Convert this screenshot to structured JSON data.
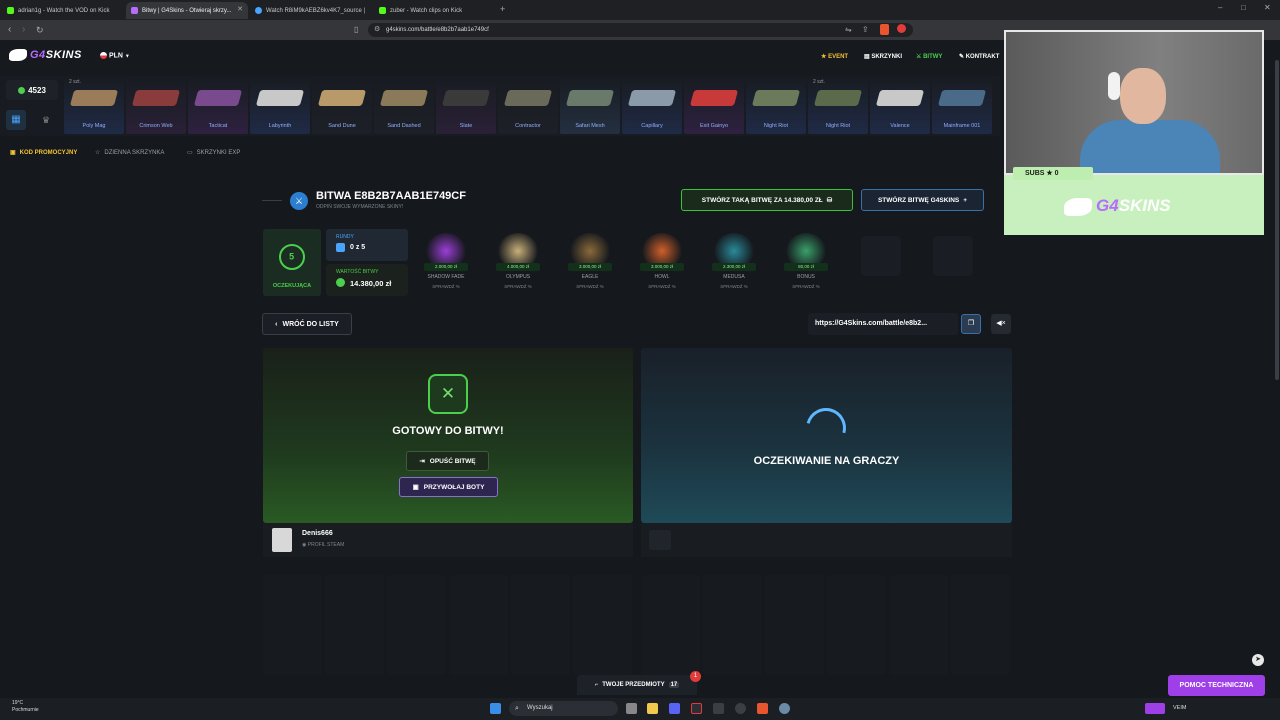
{
  "browser": {
    "tabs": [
      {
        "title": "adrian1g - Watch the VOD on Kick",
        "color": "#53fc18"
      },
      {
        "title": "Bitwy | G4Skins - Otwieraj skrzy...",
        "color": "#b86bff"
      },
      {
        "title": "Watch R8iM9kAEBZ6kv4K7_source |",
        "color": "#4aa3ff"
      },
      {
        "title": "zuber - Watch clips on Kick",
        "color": "#53fc18"
      }
    ],
    "url": "g4skins.com/battle/e8b2b7aab1e749cf"
  },
  "header": {
    "logo_prefix": "G4",
    "logo_suffix": "SKINS",
    "currency": "PLN",
    "nav": {
      "event": "EVENT",
      "cases": "SKRZYNKI",
      "battles": "BITWY",
      "contract": "KONTRAKT"
    }
  },
  "dropbar": {
    "balance": "4523",
    "drops": [
      {
        "name": "Poly Mag",
        "count": "2 szt.",
        "bg": "#1f2a45",
        "gun": "#9a7b5a"
      },
      {
        "name": "Crimson Web",
        "count": "",
        "bg": "#2a2036",
        "gun": "#8a3b3b"
      },
      {
        "name": "Tacticat",
        "count": "",
        "bg": "#2e2140",
        "gun": "#7a4a8e"
      },
      {
        "name": "Labyrinth",
        "count": "",
        "bg": "#1f2a45",
        "gun": "#c8c8c8"
      },
      {
        "name": "Sand Dune",
        "count": "",
        "bg": "#1d2026",
        "gun": "#b89a6a"
      },
      {
        "name": "Sand Dashed",
        "count": "",
        "bg": "#1d2026",
        "gun": "#8a7a5a"
      },
      {
        "name": "Slate",
        "count": "",
        "bg": "#2a2036",
        "gun": "#3a3a3a"
      },
      {
        "name": "Contractor",
        "count": "",
        "bg": "#1d2026",
        "gun": "#6a6a5a"
      },
      {
        "name": "Safari Mesh",
        "count": "",
        "bg": "#243040",
        "gun": "#6a7a6a"
      },
      {
        "name": "Capillary",
        "count": "",
        "bg": "#1f2a45",
        "gun": "#8a9aa8"
      },
      {
        "name": "Exit Gainyo",
        "count": "",
        "bg": "#2e2140",
        "gun": "#c83a3a"
      },
      {
        "name": "Night Riot",
        "count": "",
        "bg": "#1f2a45",
        "gun": "#6a7a5a"
      },
      {
        "name": "Night Riot",
        "count": "2 szt.",
        "bg": "#1f2a45",
        "gun": "#5a6a4a"
      },
      {
        "name": "Valence",
        "count": "",
        "bg": "#1f2a45",
        "gun": "#c8c8c8"
      },
      {
        "name": "Mainframe 001",
        "count": "",
        "bg": "#1f2a45",
        "gun": "#4a6a8a"
      }
    ]
  },
  "subnav": {
    "promo": "KOD PROMOCYJNY",
    "daily": "DZIENNA SKRZYNKA",
    "exp": "SKRZYNKI EXP"
  },
  "battle": {
    "title": "BITWA E8B2B7AAB1E749CF",
    "subtitle": "ODPIŃ SWOJE WYMARZONE SKINY!",
    "create_same": "STWÓRZ TAKĄ BITWĘ ZA 14.380,00 ZŁ",
    "create_g4": "STWÓRZ BITWĘ G4SKINS",
    "status_number": "5",
    "status_label": "OCZEKUJĄCA",
    "rounds_label": "RUNDY",
    "rounds_value": "0 z 5",
    "value_label": "WARTOŚĆ BITWY",
    "value": "14.380,00 zł",
    "cases": [
      {
        "name": "SHADOW FADE",
        "price": "2.000,00 zł",
        "check": "SPRAWDŹ",
        "color": "#9b3fd6"
      },
      {
        "name": "OLYMPUS",
        "price": "4.000,00 zł",
        "check": "SPRAWDŹ",
        "color": "#c9b07a"
      },
      {
        "name": "EAGLE",
        "price": "3.000,00 zł",
        "check": "SPRAWDŹ",
        "color": "#8a6a3a"
      },
      {
        "name": "HOWL",
        "price": "3.000,00 zł",
        "check": "SPRAWDŹ",
        "color": "#d0602a"
      },
      {
        "name": "MEDUSA",
        "price": "2.300,00 zł",
        "check": "SPRAWDŹ",
        "color": "#2a8a9a"
      },
      {
        "name": "BONUS",
        "price": "80,00 zł",
        "check": "SPRAWDŹ",
        "color": "#3aa06a"
      }
    ],
    "back": "WRÓĆ DO LISTY",
    "share_url": "https://G4Skins.com/battle/e8b2...",
    "ready": "GOTOWY DO BITWY!",
    "leave": "OPUŚĆ BITWĘ",
    "bots": "PRZYWOŁAJ BOTY",
    "waiting": "OCZEKIWANIE NA GRACZY",
    "player_name": "Denis666",
    "player_profile": "PROFIL STEAM"
  },
  "overlay": {
    "subs": "SUBS ★ 0",
    "banner_prefix": "G4",
    "banner_suffix": "SKINS"
  },
  "footer": {
    "items_label": "TWOJE PRZEDMIOTY",
    "items_count": "17",
    "items_badge": "1",
    "help": "POMOC TECHNICZNA"
  },
  "taskbar": {
    "temp": "19°C",
    "weather": "Pochmurnie",
    "search": "Wyszukaj",
    "user": "VEIM"
  }
}
